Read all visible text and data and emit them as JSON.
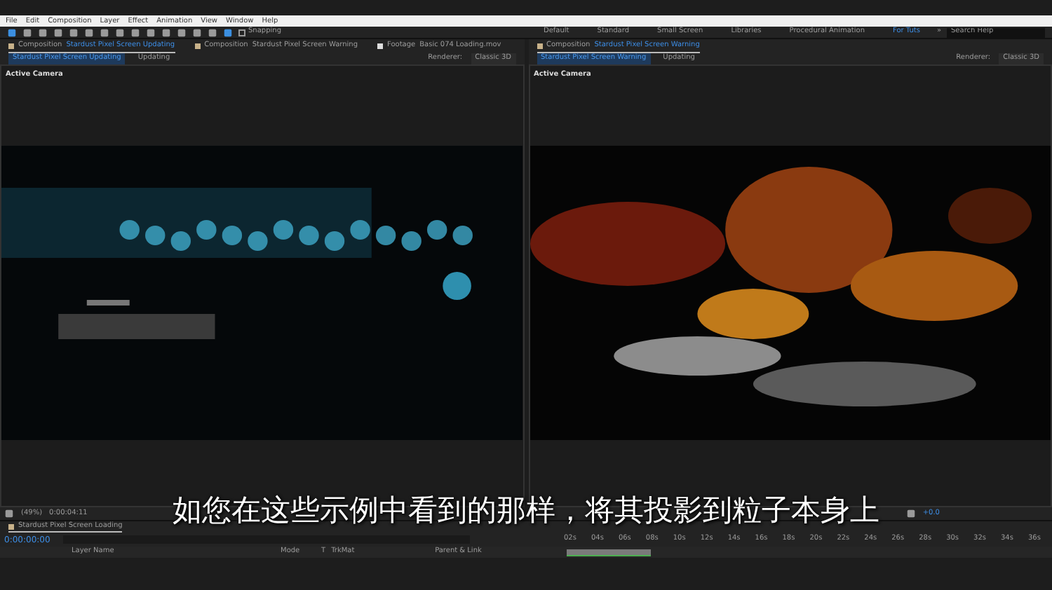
{
  "menu": [
    "File",
    "Edit",
    "Composition",
    "Layer",
    "Effect",
    "Animation",
    "View",
    "Window",
    "Help"
  ],
  "snapping": {
    "label": "Snapping",
    "checked": false
  },
  "workspaces": [
    {
      "label": "Default",
      "selected": false
    },
    {
      "label": "Standard",
      "selected": false
    },
    {
      "label": "Small Screen",
      "selected": false
    },
    {
      "label": "Libraries",
      "selected": false
    },
    {
      "label": "Procedural Animation",
      "selected": false
    },
    {
      "label": "For Tuts",
      "selected": true
    }
  ],
  "more_workspaces": "»",
  "search_help": {
    "placeholder": "Search Help"
  },
  "panels": [
    {
      "tabs": [
        {
          "kind": "composition",
          "prefix": "Composition",
          "name": "Stardust Pixel Screen Updating",
          "selected": true
        },
        {
          "kind": "composition",
          "prefix": "Composition",
          "name": "Stardust Pixel Screen Warning",
          "selected": false
        },
        {
          "kind": "footage",
          "prefix": "Footage",
          "name": "Basic 074 Loading.mov",
          "selected": false
        }
      ],
      "breadcrumbs": [
        {
          "label": "Stardust Pixel Screen Updating",
          "selected": true
        },
        {
          "label": "Updating",
          "selected": false
        }
      ],
      "renderer_label": "Renderer:",
      "renderer": "Classic 3D",
      "camera": "Active Camera",
      "footer": [
        "(49%)",
        "0:00:04:11"
      ]
    },
    {
      "tabs": [
        {
          "kind": "composition",
          "prefix": "Composition",
          "name": "Stardust Pixel Screen Warning",
          "selected": true
        }
      ],
      "breadcrumbs": [
        {
          "label": "Stardust Pixel Screen Warning",
          "selected": true
        },
        {
          "label": "Updating",
          "selected": false
        }
      ],
      "renderer_label": "Renderer:",
      "renderer": "Classic 3D",
      "camera": "Active Camera",
      "footer": [
        "+0.0"
      ]
    }
  ],
  "timeline": {
    "tab": "Stardust Pixel Screen Loading",
    "timecode": "0:00:00:00",
    "columns": [
      "Layer Name",
      "Mode",
      "T",
      "TrkMat",
      "Parent & Link"
    ],
    "ruler": [
      "02s",
      "04s",
      "06s",
      "08s",
      "10s",
      "12s",
      "14s",
      "16s",
      "18s",
      "20s",
      "22s",
      "24s",
      "26s",
      "28s",
      "30s",
      "32s",
      "34s",
      "36s"
    ]
  },
  "subtitle": "如您在这些示例中看到的那样，将其投影到粒子本身上"
}
